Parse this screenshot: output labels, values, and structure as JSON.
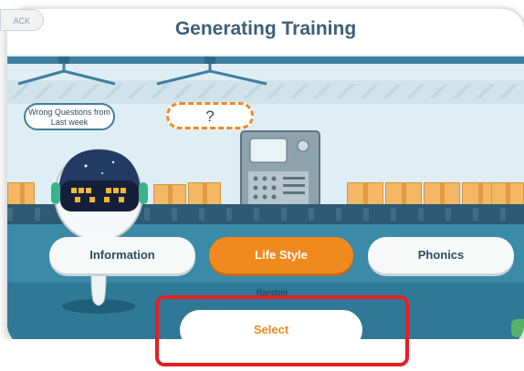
{
  "header": {
    "title": "Generating Training",
    "back_label": "ACK"
  },
  "signs": {
    "left": "Wrong Questions from Last week",
    "center": "?"
  },
  "categories": [
    {
      "label": "Information",
      "selected": false
    },
    {
      "label": "Life Style",
      "selected": true
    },
    {
      "label": "Phonics",
      "selected": false
    }
  ],
  "random_label": "Random",
  "select_label": "Select",
  "colors": {
    "accent": "#f08a1e",
    "title": "#3c5f77",
    "highlight": "#e61e24",
    "belt": "#2f5a74"
  },
  "icons": [
    "robot-mascot-icon",
    "training-machine-icon",
    "ceiling-hook-icon",
    "cardboard-box-icon"
  ]
}
